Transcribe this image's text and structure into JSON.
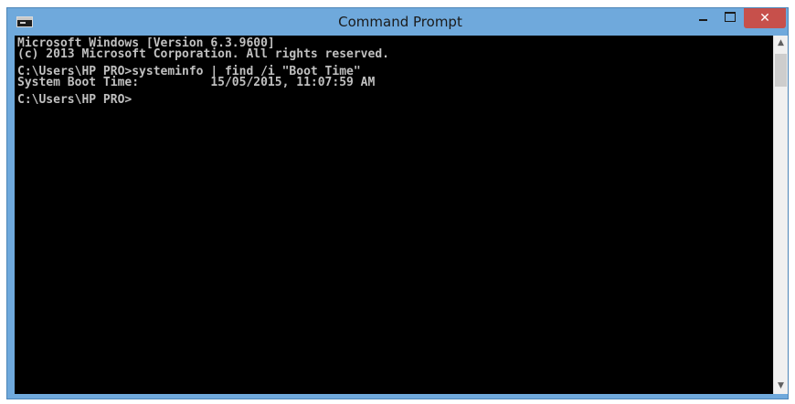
{
  "window": {
    "title": "Command Prompt",
    "close_glyph": "✕",
    "accent_color": "#6fa9dc",
    "close_color": "#c7504b"
  },
  "console": {
    "lines": [
      "Microsoft Windows [Version 6.3.9600]",
      "(c) 2013 Microsoft Corporation. All rights reserved.",
      "",
      "C:\\Users\\HP PRO>systeminfo | find /i \"Boot Time\"",
      "System Boot Time:          15/05/2015, 11:07:59 AM",
      "",
      "C:\\Users\\HP PRO>"
    ],
    "text_color": "#c0c0c0",
    "background_color": "#000000"
  },
  "scrollbar": {
    "up_glyph": "▲",
    "down_glyph": "▼"
  },
  "icons": {
    "app": "console-window-icon",
    "minimize": "minimize-icon",
    "maximize": "maximize-icon",
    "close": "close-icon"
  }
}
